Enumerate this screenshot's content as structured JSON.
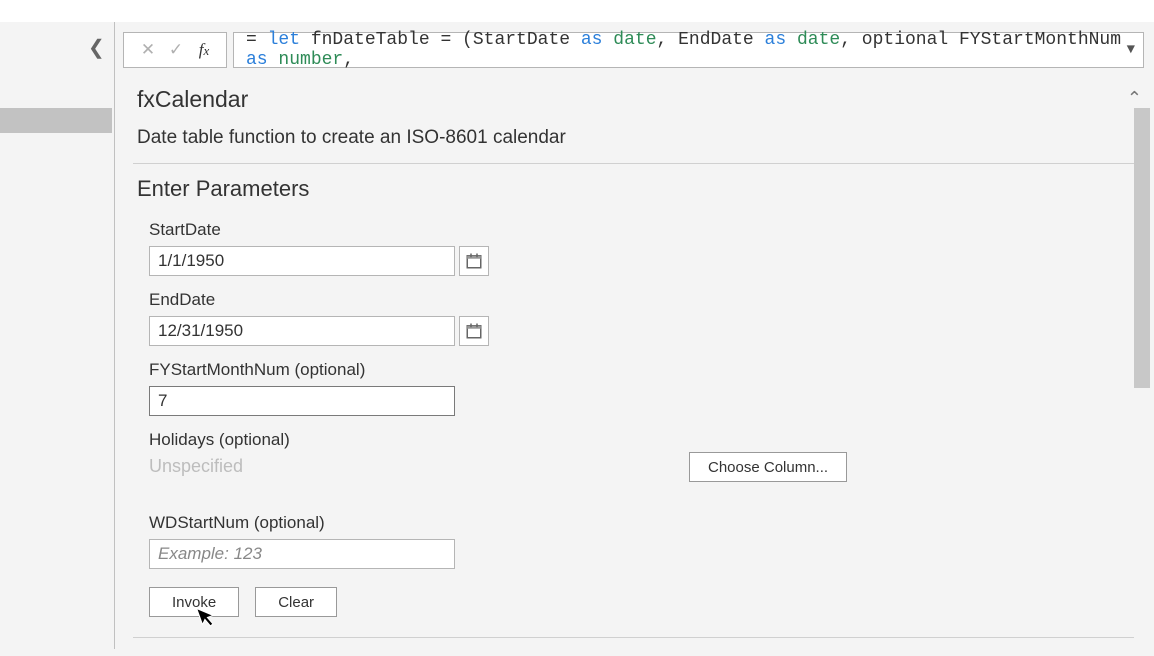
{
  "formula": {
    "text_prefix": "= ",
    "kw_let": "let",
    "fn_name": " fnDateTable = (StartDate ",
    "kw_as1": "as",
    "sp1": " ",
    "typ_date1": "date",
    "mid1": ", EndDate ",
    "kw_as2": "as",
    "sp2": " ",
    "typ_date2": "date",
    "mid2": ", optional FYStartMonthNum ",
    "kw_as3": "as",
    "sp3": " ",
    "typ_number": "number",
    "tail": ","
  },
  "fn_title": "fxCalendar",
  "fn_desc": "Date table function to create an ISO-8601 calendar",
  "section_h": "Enter Parameters",
  "params": {
    "startdate": {
      "label": "StartDate",
      "value": "1/1/1950"
    },
    "enddate": {
      "label": "EndDate",
      "value": "12/31/1950"
    },
    "fystart": {
      "label": "FYStartMonthNum (optional)",
      "value": "7"
    },
    "holidays": {
      "label": "Holidays (optional)",
      "unspecified": "Unspecified",
      "choose": "Choose Column..."
    },
    "wdstart": {
      "label": "WDStartNum (optional)",
      "placeholder": "Example: 123"
    }
  },
  "buttons": {
    "invoke": "Invoke",
    "clear": "Clear"
  }
}
